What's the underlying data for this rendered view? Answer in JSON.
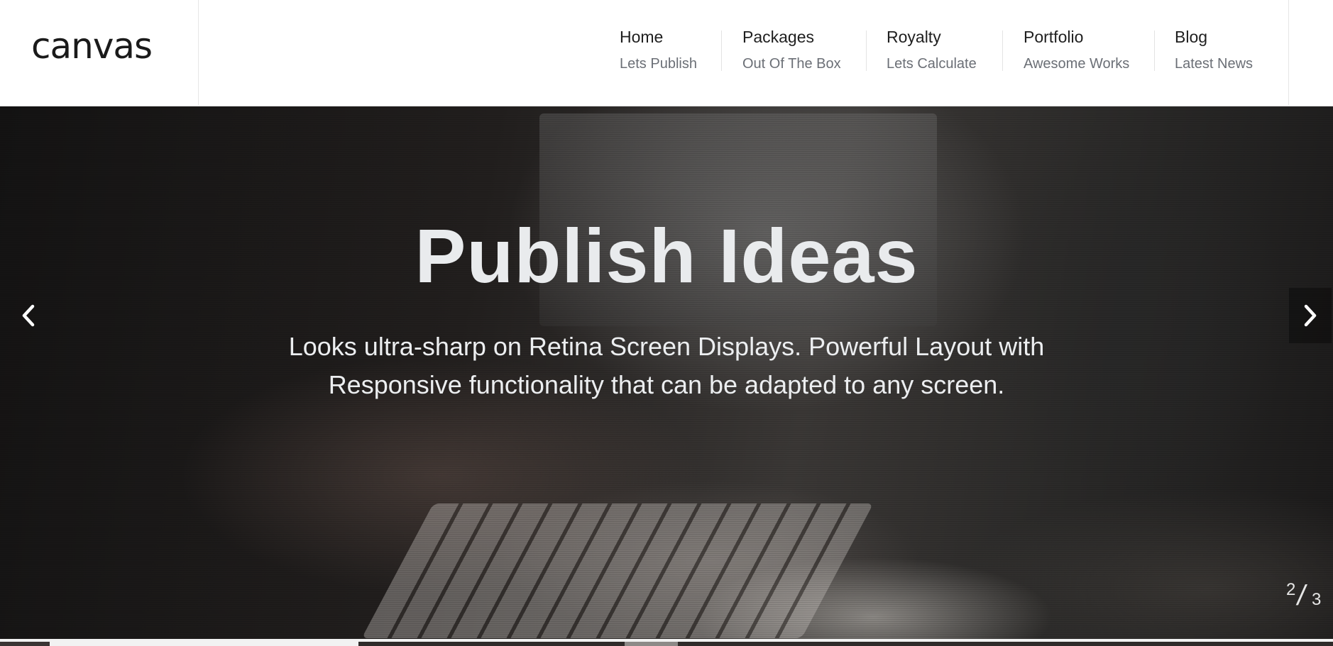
{
  "brand": {
    "logo_text": "canvas"
  },
  "nav": {
    "items": [
      {
        "title": "Home",
        "subtitle": "Lets Publish"
      },
      {
        "title": "Packages",
        "subtitle": "Out Of The Box"
      },
      {
        "title": "Royalty",
        "subtitle": "Lets Calculate"
      },
      {
        "title": "Portfolio",
        "subtitle": "Awesome Works"
      },
      {
        "title": "Blog",
        "subtitle": "Latest News"
      }
    ]
  },
  "hero": {
    "title": "Publish Ideas",
    "subtitle": "Looks ultra-sharp on Retina Screen Displays. Powerful Layout with Responsive functionality that can be adapted to any screen.",
    "prev_icon": "chevron-left-icon",
    "next_icon": "chevron-right-icon",
    "counter": {
      "current": "2",
      "total": "3"
    }
  },
  "colors": {
    "nav_title": "#1f1f1f",
    "nav_subtitle": "#6b6f76",
    "hero_text": "#e9ebed"
  }
}
